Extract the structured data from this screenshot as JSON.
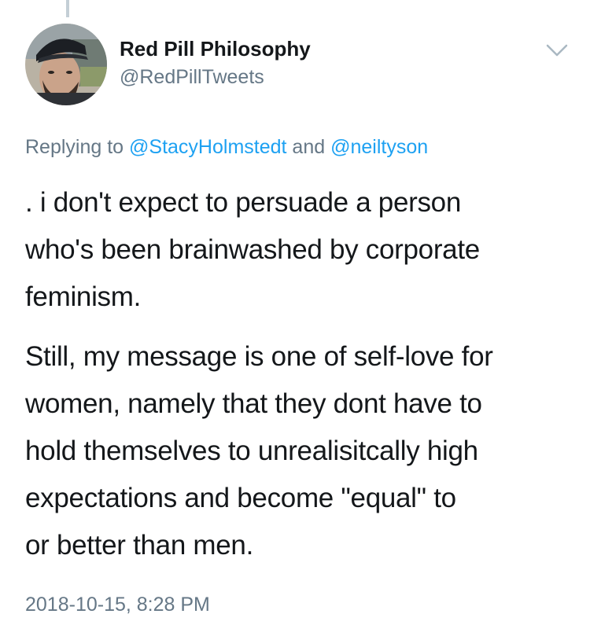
{
  "tweet": {
    "display_name": "Red Pill Philosophy",
    "handle": "@RedPillTweets",
    "replying_prefix": "Replying to ",
    "reply_to_1": "@StacyHolmstedt",
    "reply_joiner": " and ",
    "reply_to_2": "@neiltyson",
    "paragraphs": [
      ". i don't expect to persuade a person\nwho's been brainwashed by corporate\nfeminism.",
      "Still, my message is one of self-love for\nwomen, namely that they dont have to\nhold themselves to unrealisitcally high\nexpectations and become \"equal\" to\nor better than men."
    ],
    "timestamp": "2018-10-15, 8:28 PM"
  },
  "icons": {
    "caret": "chevron-down-icon",
    "avatar": "profile-photo"
  },
  "colors": {
    "text_primary": "#14171a",
    "text_secondary": "#657786",
    "link": "#1da1f2",
    "thread_line": "#c4cfd6"
  }
}
